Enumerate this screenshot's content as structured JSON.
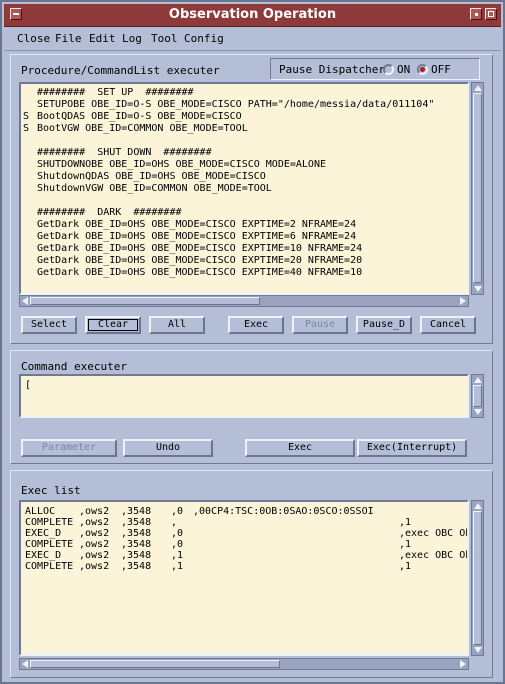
{
  "window": {
    "title": "Observation Operation"
  },
  "menu": [
    "Close",
    "File",
    "Edit",
    "Log",
    "Tool",
    "Config"
  ],
  "procedure": {
    "label": "Procedure/CommandList executer",
    "pause_dispatcher": {
      "label": "Pause Dispatcher",
      "on_label": "ON",
      "off_label": "OFF",
      "selected": "OFF"
    },
    "lines": [
      {
        "mark": "",
        "text": "########  SET UP  ########"
      },
      {
        "mark": "",
        "text": "SETUPOBE OBE_ID=O-S OBE_MODE=CISCO PATH=\"/home/messia/data/011104\""
      },
      {
        "mark": "S",
        "text": "BootQDAS OBE_ID=O-S OBE_MODE=CISCO"
      },
      {
        "mark": "S",
        "text": "BootVGW OBE_ID=COMMON OBE_MODE=TOOL"
      },
      {
        "mark": "",
        "text": ""
      },
      {
        "mark": "",
        "text": "########  SHUT DOWN  ########"
      },
      {
        "mark": "",
        "text": "SHUTDOWNOBE OBE_ID=OHS OBE_MODE=CISCO MODE=ALONE"
      },
      {
        "mark": "",
        "text": "ShutdownQDAS OBE_ID=OHS OBE_MODE=CISCO"
      },
      {
        "mark": "",
        "text": "ShutdownVGW OBE_ID=COMMON OBE_MODE=TOOL"
      },
      {
        "mark": "",
        "text": ""
      },
      {
        "mark": "",
        "text": "########  DARK  ########"
      },
      {
        "mark": "",
        "text": "GetDark OBE_ID=OHS OBE_MODE=CISCO EXPTIME=2 NFRAME=24"
      },
      {
        "mark": "",
        "text": "GetDark OBE_ID=OHS OBE_MODE=CISCO EXPTIME=6 NFRAME=24"
      },
      {
        "mark": "",
        "text": "GetDark OBE_ID=OHS OBE_MODE=CISCO EXPTIME=10 NFRAME=24"
      },
      {
        "mark": "",
        "text": "GetDark OBE_ID=OHS OBE_MODE=CISCO EXPTIME=20 NFRAME=20"
      },
      {
        "mark": "",
        "text": "GetDark OBE_ID=OHS OBE_MODE=CISCO EXPTIME=40 NFRAME=10"
      }
    ],
    "buttons": {
      "select": "Select",
      "clear": "Clear",
      "all": "All",
      "exec": "Exec",
      "pause": "Pause",
      "pause_d": "Pause_D",
      "cancel": "Cancel"
    }
  },
  "command": {
    "label": "Command executer",
    "input_value": "[",
    "buttons": {
      "parameter": "Parameter",
      "undo": "Undo",
      "exec": "Exec",
      "exec_interrupt": "Exec(Interrupt)"
    }
  },
  "exec_list": {
    "label": "Exec list",
    "rows": [
      {
        "c1": "ALLOC",
        "c2": ",ows2",
        "c3": ",3548",
        "c4": ",0",
        "c5": ",00CP4:TSC:0OB:0SAO:0SCO:0SSOI",
        "c6": ""
      },
      {
        "c1": "COMPLETE",
        "c2": ",ows2",
        "c3": ",3548",
        "c4": ",",
        "c5": "",
        "c6": ",1"
      },
      {
        "c1": "EXEC_D",
        "c2": ",ows2",
        "c3": ",3548",
        "c4": ",0",
        "c5": "",
        "c6": ",exec OBC Ob:"
      },
      {
        "c1": "COMPLETE",
        "c2": ",ows2",
        "c3": ",3548",
        "c4": ",0",
        "c5": "",
        "c6": ",1"
      },
      {
        "c1": "EXEC_D",
        "c2": ",ows2",
        "c3": ",3548",
        "c4": ",1",
        "c5": "",
        "c6": ",exec OBC Ob."
      },
      {
        "c1": "COMPLETE",
        "c2": ",ows2",
        "c3": ",3548",
        "c4": ",1",
        "c5": "",
        "c6": ",1"
      }
    ]
  }
}
